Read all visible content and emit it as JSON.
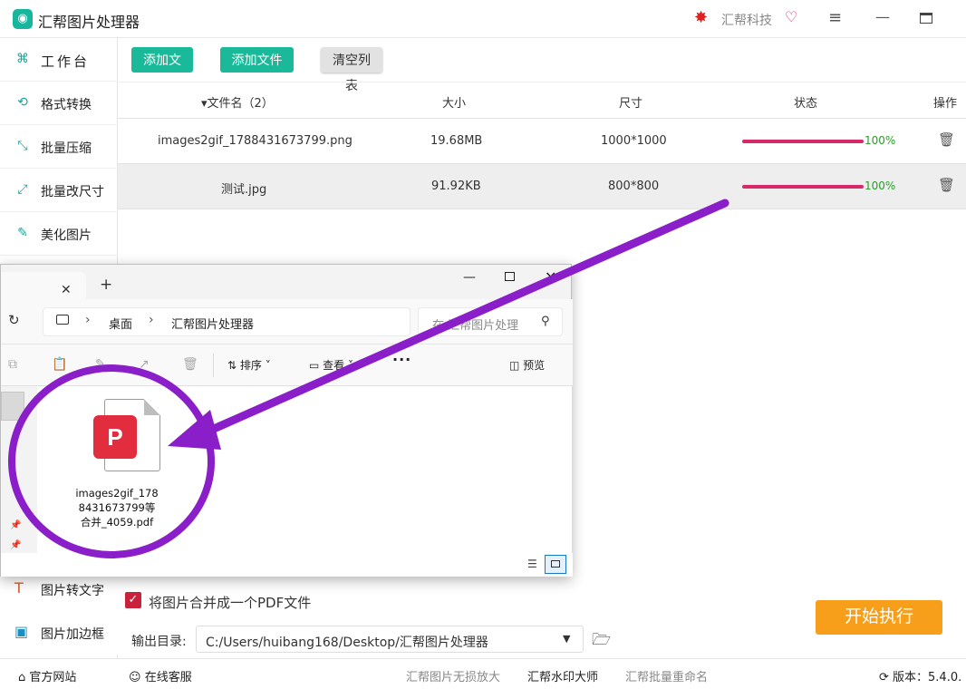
{
  "app": {
    "title": "汇帮图片处理器",
    "brand": "汇帮科技"
  },
  "sidebar": {
    "items": [
      {
        "label": "工作台",
        "icon": "workbench-icon"
      },
      {
        "label": "格式转换",
        "icon": "convert-icon"
      },
      {
        "label": "批量压缩",
        "icon": "compress-icon"
      },
      {
        "label": "批量改尺寸",
        "icon": "resize-icon"
      },
      {
        "label": "美化图片",
        "icon": "beautify-icon"
      }
    ],
    "lower_items": [
      {
        "label": "图片转文字",
        "icon": "ocr-icon"
      },
      {
        "label": "图片加边框",
        "icon": "border-icon"
      }
    ]
  },
  "toolbar": {
    "add_file": "添加文件",
    "add_folder": "添加文件夹",
    "clear_list": "清空列表"
  },
  "table": {
    "headers": {
      "name": "▾文件名（2）",
      "size": "大小",
      "dimensions": "尺寸",
      "status": "状态",
      "action": "操作"
    },
    "rows": [
      {
        "name": "images2gif_1788431673799.png",
        "size": "19.68MB",
        "dimensions": "1000*1000",
        "progress": 1.0,
        "percent": "100%"
      },
      {
        "name": "测试.jpg",
        "size": "91.92KB",
        "dimensions": "800*800",
        "progress": 1.0,
        "percent": "100%"
      }
    ]
  },
  "explorer": {
    "breadcrumb": [
      "桌面",
      "汇帮图片处理器"
    ],
    "search_placeholder": "在 汇帮图片处理",
    "sort_label": "排序",
    "view_label": "查看",
    "more_label": "···",
    "preview_label": "预览",
    "file": {
      "name_line1": "images2gif_178",
      "name_line2": "8431673799等",
      "name_line3": "合并_4059.pdf",
      "badge": "P"
    }
  },
  "settings": {
    "merge_label": "将图片合并成一个PDF文件",
    "merge_checked": true,
    "output_label": "输出目录:",
    "output_path": "C:/Users/huibang168/Desktop/汇帮图片处理器",
    "start_button": "开始执行"
  },
  "footer": {
    "website": "官方网站",
    "support": "在线客服",
    "link1": "汇帮图片无损放大",
    "link2": "汇帮水印大师",
    "link3": "汇帮批量重命名",
    "version": "版本：5.4.0."
  },
  "colors": {
    "accent": "#19b99a",
    "progress": "#d7286a",
    "start": "#f79f1a",
    "annotation": "#8a1ec8"
  }
}
